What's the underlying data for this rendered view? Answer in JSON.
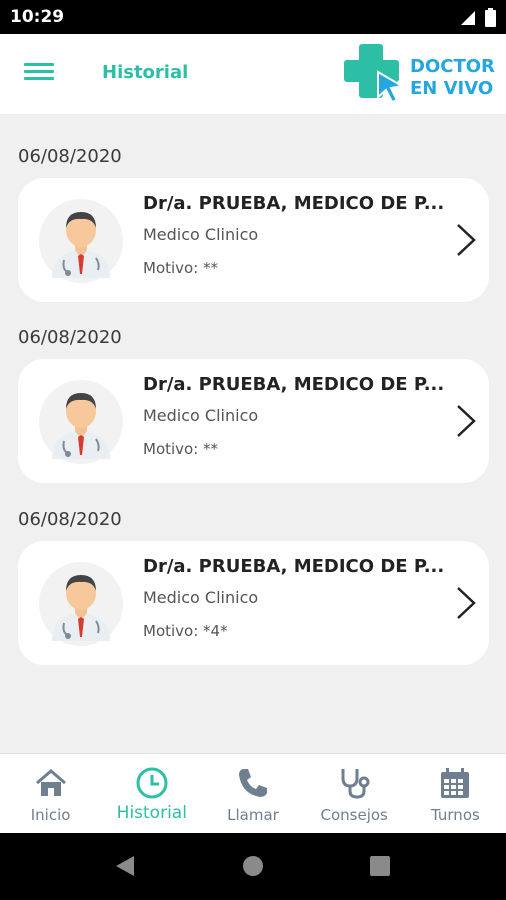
{
  "status_bar": {
    "time": "10:29"
  },
  "header": {
    "title": "Historial",
    "logo_line1": "DOCTOR",
    "logo_line2": "EN VIVO"
  },
  "appointments": [
    {
      "date": "06/08/2020",
      "doctor": "Dr/a. PRUEBA, MEDICO DE P...",
      "specialty": "Medico Clinico",
      "motivo": "Motivo: **"
    },
    {
      "date": "06/08/2020",
      "doctor": "Dr/a. PRUEBA, MEDICO DE P...",
      "specialty": "Medico Clinico",
      "motivo": "Motivo: **"
    },
    {
      "date": "06/08/2020",
      "doctor": "Dr/a. PRUEBA, MEDICO DE P...",
      "specialty": "Medico Clinico",
      "motivo": "Motivo: *4*"
    }
  ],
  "bottom_nav": [
    {
      "label": "Inicio",
      "icon": "home-icon"
    },
    {
      "label": "Historial",
      "icon": "clock-icon",
      "active": true
    },
    {
      "label": "Llamar",
      "icon": "phone-icon"
    },
    {
      "label": "Consejos",
      "icon": "stethoscope-icon"
    },
    {
      "label": "Turnos",
      "icon": "calendar-icon"
    }
  ],
  "colors": {
    "accent": "#2cbfa6",
    "logo_blue": "#24a7e0",
    "nav_gray": "#6f7f8f"
  }
}
